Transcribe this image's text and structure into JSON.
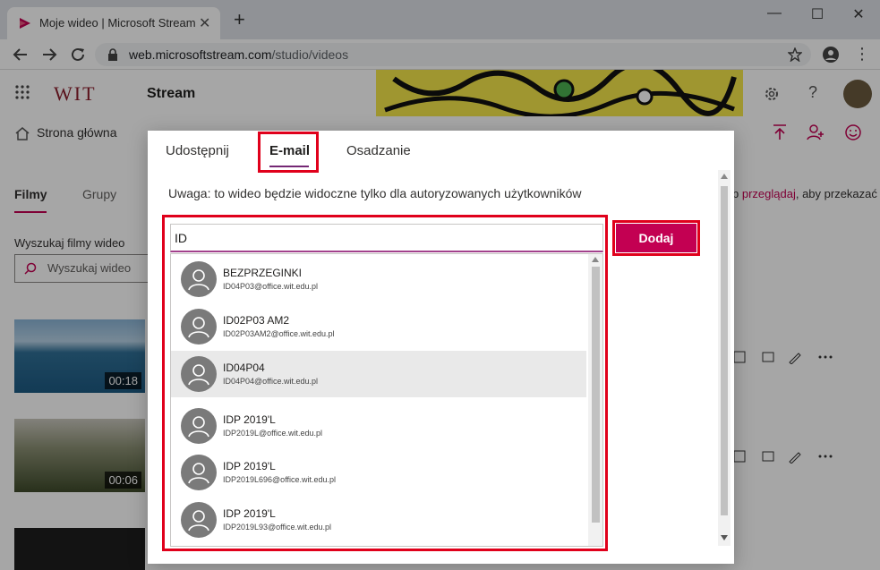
{
  "browser": {
    "tab_title": "Moje wideo | Microsoft Stream",
    "tab_close": "✕",
    "new_tab": "+",
    "minimize": "—",
    "maximize": "☐",
    "close": "✕",
    "url_host": "web.microsoftstream.com",
    "url_path": "/studio/videos"
  },
  "app": {
    "logo": "WIT",
    "title": "Stream"
  },
  "nav": {
    "home": "Strona główna"
  },
  "background": {
    "tab_films": "Filmy",
    "tab_groups": "Grupy",
    "search_label": "Wyszukaj filmy wideo",
    "search_placeholder": "Wyszukaj wideo",
    "hint_link": "przeglądaj",
    "hint_rest": ", aby przekazać",
    "hint_prefix": "b ",
    "video1_duration": "00:18",
    "video2_duration": "00:06"
  },
  "dialog": {
    "tabs": [
      {
        "label": "Udostępnij"
      },
      {
        "label": "E-mail"
      },
      {
        "label": "Osadzanie"
      }
    ],
    "notice": "Uwaga: to wideo będzie widoczne tylko dla autoryzowanych użytkowników",
    "input_value": "ID",
    "add_button": "Dodaj",
    "suggestions": [
      {
        "name": "BEZPRZEGINKI",
        "email": "ID04P03@office.wit.edu.pl"
      },
      {
        "name": "ID02P03 AM2",
        "email": "ID02P03AM2@office.wit.edu.pl"
      },
      {
        "name": "ID04P04",
        "email": "ID04P04@office.wit.edu.pl"
      },
      {
        "name": "IDP 2019'L",
        "email": "IDP2019L@office.wit.edu.pl"
      },
      {
        "name": "IDP 2019'L",
        "email": "IDP2019L696@office.wit.edu.pl"
      },
      {
        "name": "IDP 2019'L",
        "email": "IDP2019L93@office.wit.edu.pl"
      }
    ]
  },
  "colors": {
    "accent": "#c30052",
    "highlight": "#e0001b",
    "tab_underline": "#742774"
  }
}
